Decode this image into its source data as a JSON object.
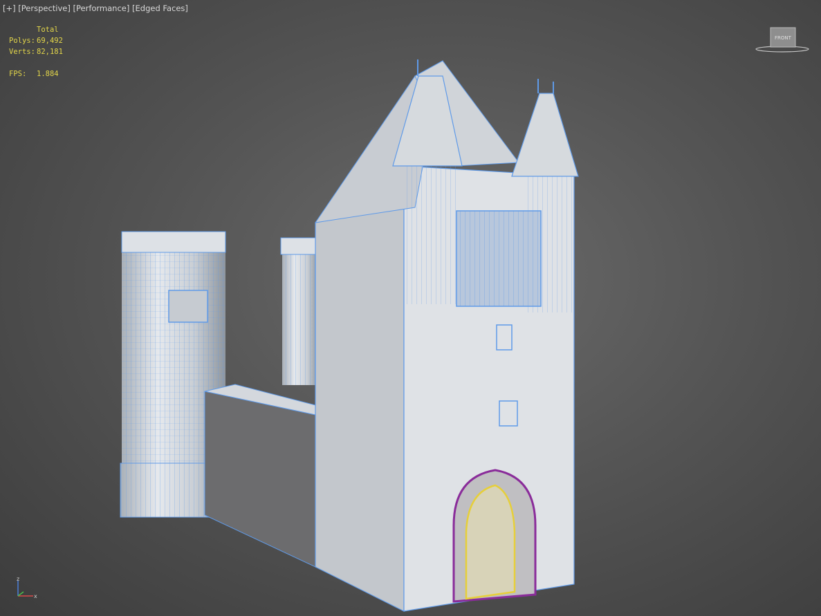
{
  "viewport": {
    "labels": {
      "plus": "[+]",
      "view": "[Perspective]",
      "mode": "[Performance]",
      "shading": "[Edged Faces]"
    },
    "stats": {
      "header": "Total",
      "polys_label": "Polys:",
      "polys": "69,492",
      "verts_label": "Verts:",
      "verts": "82,181",
      "fps_label": "FPS:",
      "fps": "1.884"
    },
    "viewcube_label": "FRONT",
    "axis": {
      "z": "z",
      "x": "x"
    },
    "colors": {
      "background": "#5a5a5a",
      "stats_text": "#e3d64a",
      "wire": "#5f9ae8",
      "gate_arch": "#8a2c9a",
      "gate_door": "#e6cf3a",
      "model_light": "#d8dce1",
      "model_dark": "#6e6e70"
    }
  }
}
